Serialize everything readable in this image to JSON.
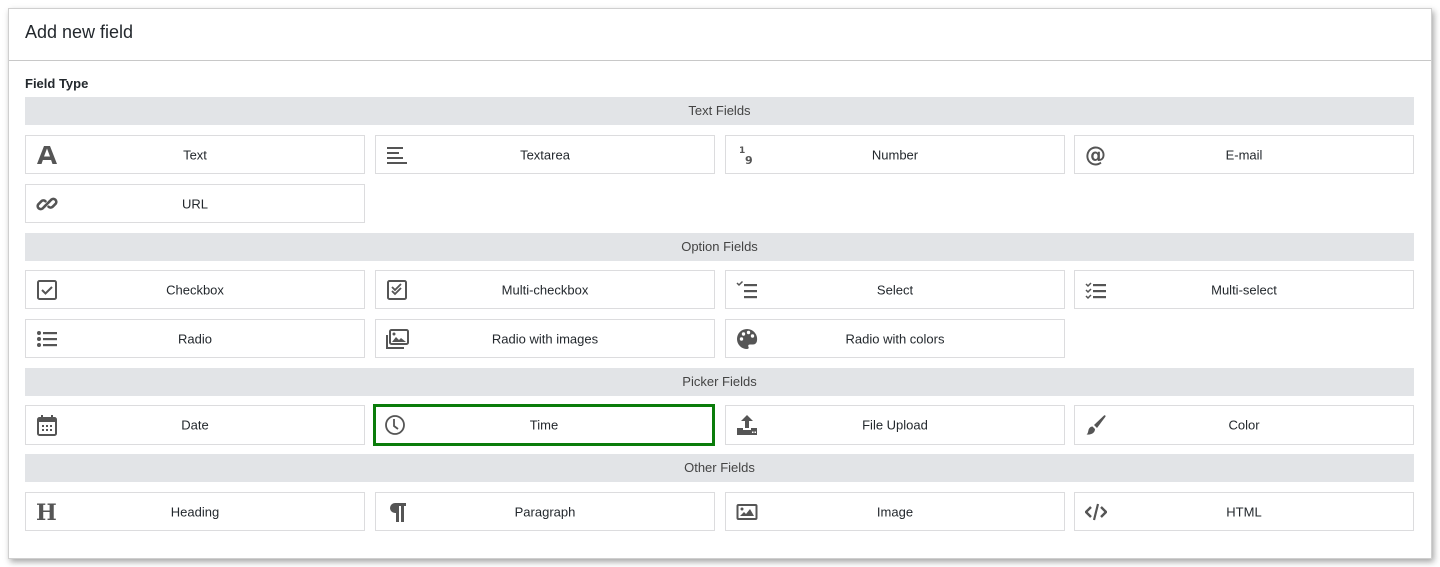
{
  "header": {
    "title": "Add new field"
  },
  "form": {
    "field_type_label": "Field Type"
  },
  "sections": [
    {
      "title": "Text Fields",
      "items": [
        {
          "label": "Text",
          "icon": "text-icon"
        },
        {
          "label": "Textarea",
          "icon": "textarea-icon"
        },
        {
          "label": "Number",
          "icon": "number-icon"
        },
        {
          "label": "E-mail",
          "icon": "email-icon"
        },
        {
          "label": "URL",
          "icon": "link-icon"
        }
      ]
    },
    {
      "title": "Option Fields",
      "items": [
        {
          "label": "Checkbox",
          "icon": "checkbox-icon"
        },
        {
          "label": "Multi-checkbox",
          "icon": "multi-checkbox-icon"
        },
        {
          "label": "Select",
          "icon": "select-icon"
        },
        {
          "label": "Multi-select",
          "icon": "multi-select-icon"
        },
        {
          "label": "Radio",
          "icon": "radio-list-icon"
        },
        {
          "label": "Radio with images",
          "icon": "images-icon"
        },
        {
          "label": "Radio with colors",
          "icon": "palette-icon"
        }
      ]
    },
    {
      "title": "Picker Fields",
      "items": [
        {
          "label": "Date",
          "icon": "calendar-icon"
        },
        {
          "label": "Time",
          "icon": "clock-icon",
          "selected": true
        },
        {
          "label": "File Upload",
          "icon": "upload-icon"
        },
        {
          "label": "Color",
          "icon": "paintbrush-icon"
        }
      ]
    },
    {
      "title": "Other Fields",
      "items": [
        {
          "label": "Heading",
          "icon": "heading-icon"
        },
        {
          "label": "Paragraph",
          "icon": "paragraph-icon"
        },
        {
          "label": "Image",
          "icon": "image-icon"
        },
        {
          "label": "HTML",
          "icon": "code-icon"
        }
      ]
    }
  ],
  "colors": {
    "selected_border": "#0a7c0a",
    "section_bg": "#e2e4e7",
    "icon": "#555555"
  }
}
